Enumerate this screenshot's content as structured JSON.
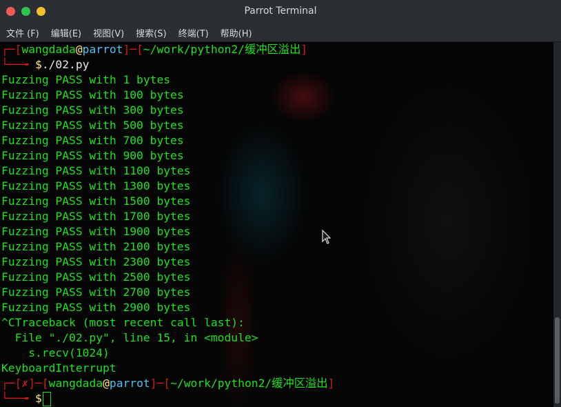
{
  "window": {
    "title": "Parrot Terminal"
  },
  "menu": [
    "文件 (F)",
    "编辑(E)",
    "视图(V)",
    "搜索(S)",
    "终端(T)",
    "帮助(H)"
  ],
  "prompt": {
    "corner_top": "┌─[",
    "user": "wangdada",
    "at": "@",
    "host": "parrot",
    "sep": "]─[",
    "path": "~/work/python2/缓冲区溢出",
    "close": "]",
    "corner_bottom": "└──╼ ",
    "dollar": "$",
    "command": "./02.py",
    "error_mark": "✗",
    "prompt2_prefix": "┌─[",
    "prompt2_mid": "]─["
  },
  "output": [
    "Fuzzing PASS with 1 bytes",
    "Fuzzing PASS with 100 bytes",
    "Fuzzing PASS with 300 bytes",
    "Fuzzing PASS with 500 bytes",
    "Fuzzing PASS with 700 bytes",
    "Fuzzing PASS with 900 bytes",
    "Fuzzing PASS with 1100 bytes",
    "Fuzzing PASS with 1300 bytes",
    "Fuzzing PASS with 1500 bytes",
    "Fuzzing PASS with 1700 bytes",
    "Fuzzing PASS with 1900 bytes",
    "Fuzzing PASS with 2100 bytes",
    "Fuzzing PASS with 2300 bytes",
    "Fuzzing PASS with 2500 bytes",
    "Fuzzing PASS with 2700 bytes",
    "Fuzzing PASS with 2900 bytes",
    "^CTraceback (most recent call last):",
    "  File \"./02.py\", line 15, in <module>",
    "    s.recv(1024)",
    "KeyboardInterrupt"
  ],
  "colors": {
    "green": "#1ee11e",
    "red": "#d01c1c",
    "cyan": "#4ec2f0",
    "yellow": "#ffef72"
  }
}
